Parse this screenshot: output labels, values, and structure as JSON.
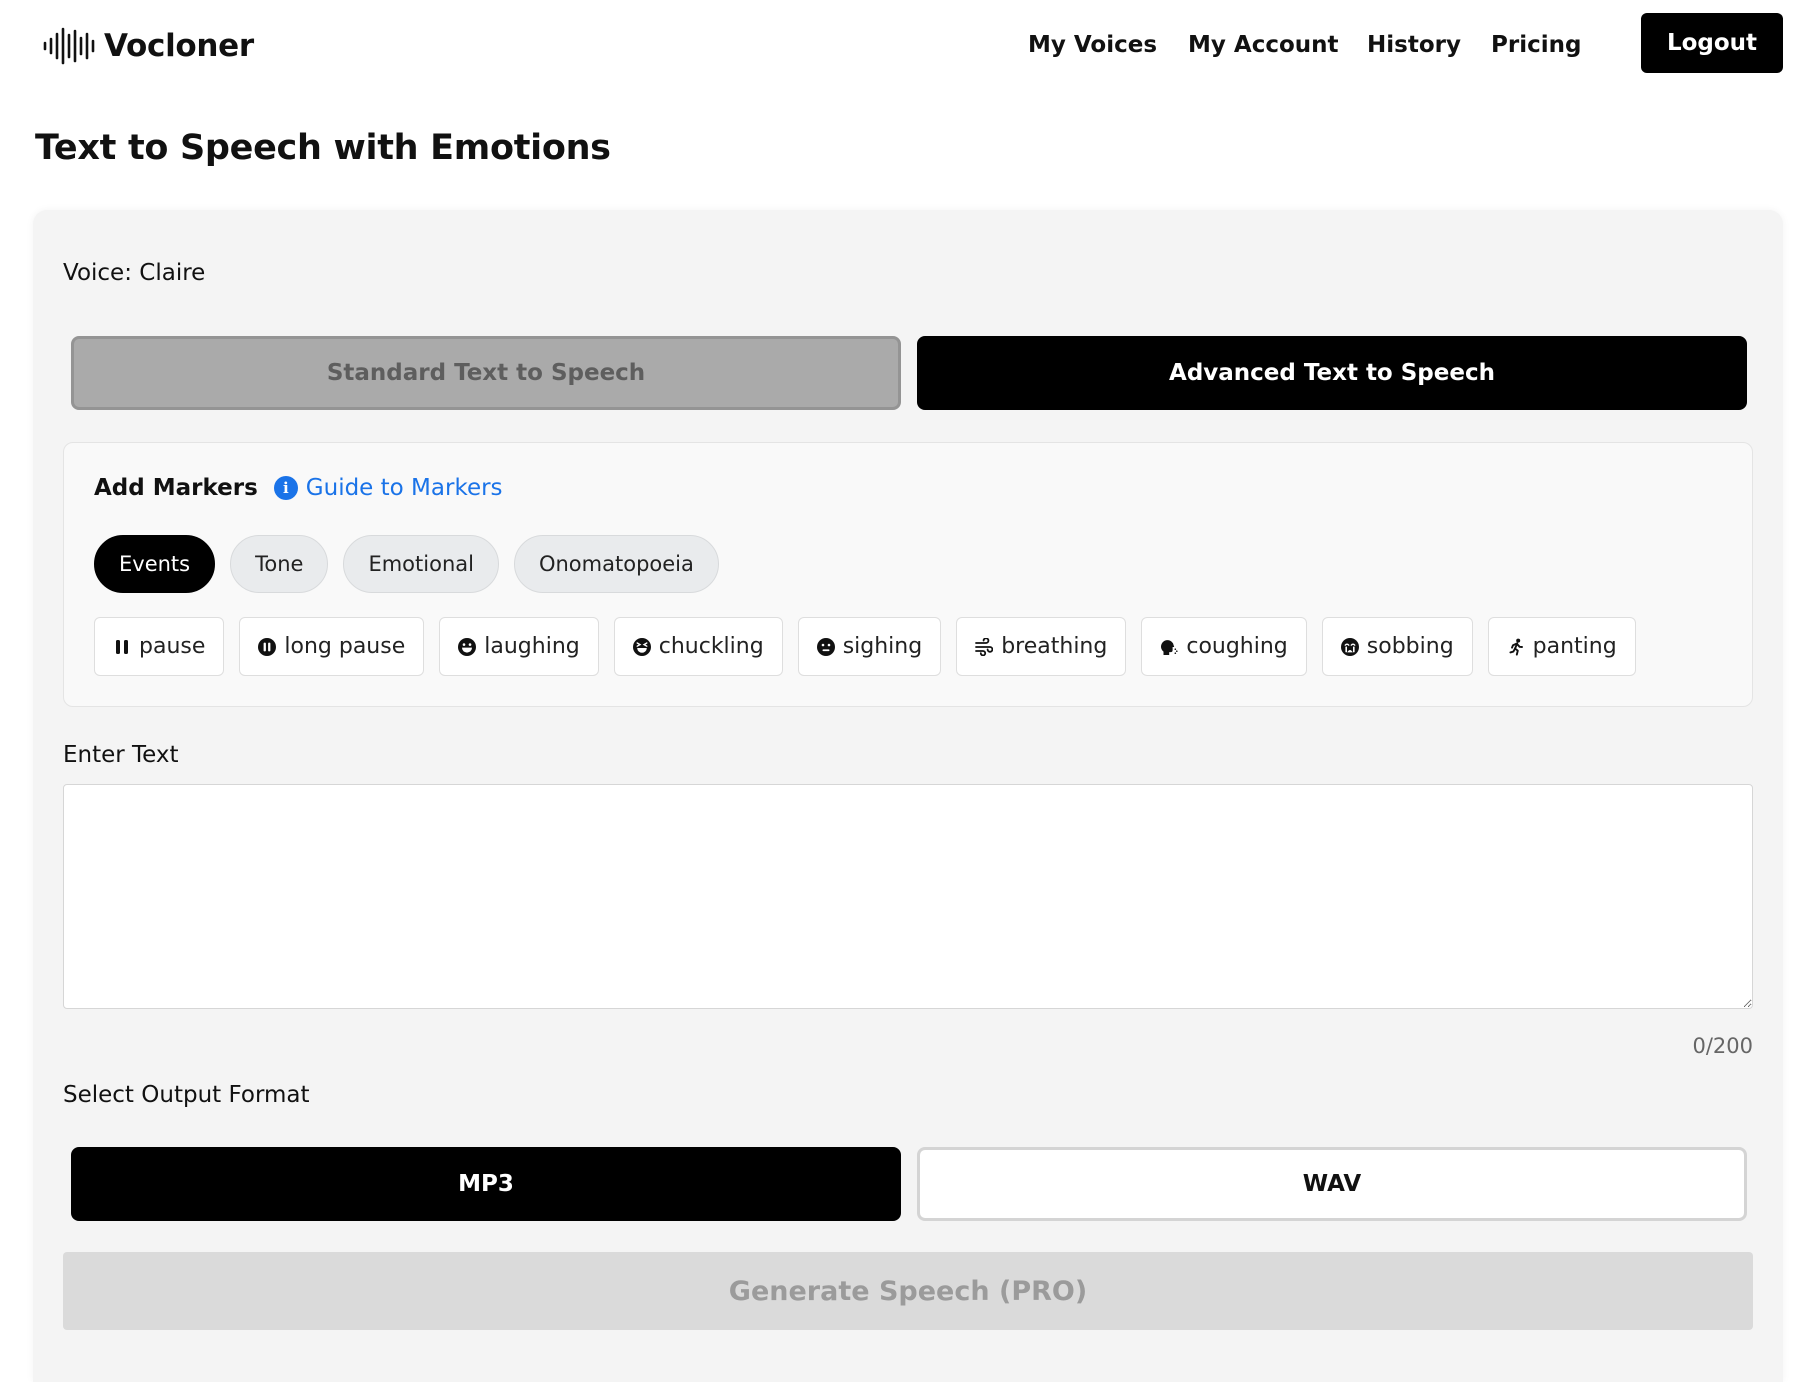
{
  "header": {
    "brand": "Vocloner",
    "nav": [
      {
        "id": "my-voices",
        "label": "My Voices"
      },
      {
        "id": "my-account",
        "label": "My Account"
      },
      {
        "id": "history",
        "label": "History"
      },
      {
        "id": "pricing",
        "label": "Pricing"
      }
    ],
    "logout_label": "Logout"
  },
  "page_title": "Text to Speech with Emotions",
  "voice": {
    "label": "Voice:",
    "name": "Claire"
  },
  "modes": {
    "standard": "Standard Text to Speech",
    "advanced": "Advanced Text to Speech",
    "selected": "advanced"
  },
  "markers": {
    "label": "Add Markers",
    "guide_link": "Guide to Markers",
    "categories": [
      "Events",
      "Tone",
      "Emotional",
      "Onomatopoeia"
    ],
    "active_category": "Events",
    "items": [
      {
        "label": "pause",
        "icon": "pause-icon"
      },
      {
        "label": "long pause",
        "icon": "pause-circle-icon"
      },
      {
        "label": "laughing",
        "icon": "laughing-face-icon"
      },
      {
        "label": "chuckling",
        "icon": "chuckling-face-icon"
      },
      {
        "label": "sighing",
        "icon": "sighing-face-icon"
      },
      {
        "label": "breathing",
        "icon": "wind-icon"
      },
      {
        "label": "coughing",
        "icon": "coughing-head-icon"
      },
      {
        "label": "sobbing",
        "icon": "sobbing-face-icon"
      },
      {
        "label": "panting",
        "icon": "running-person-icon"
      }
    ]
  },
  "text_input": {
    "label": "Enter Text",
    "value": "",
    "counter": "0/200"
  },
  "output_format": {
    "label": "Select Output Format",
    "options": [
      "MP3",
      "WAV"
    ],
    "selected": "MP3"
  },
  "generate_label": "Generate Speech (PRO)",
  "colors": {
    "accent_link": "#1a73e8",
    "primary": "#000000",
    "disabled": "#dadada"
  }
}
